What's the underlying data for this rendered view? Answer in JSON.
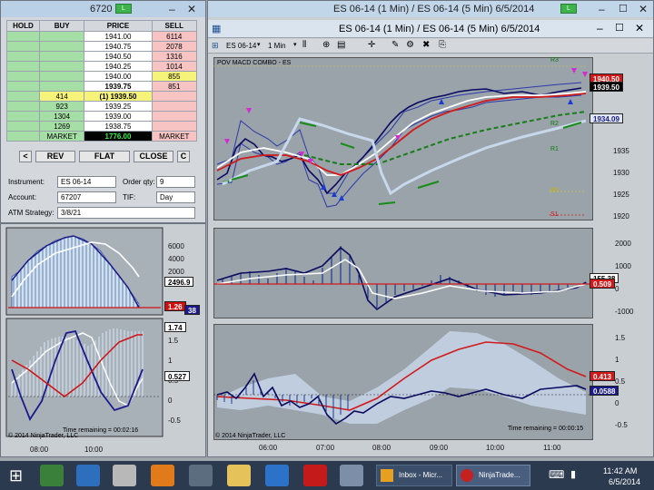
{
  "dom_window": {
    "title": "6720",
    "indicator": "L",
    "headers": [
      "HOLD",
      "BUY",
      "PRICE",
      "SELL"
    ],
    "rows": [
      {
        "hold": "",
        "buy": "",
        "price": "1941.00",
        "sell": "6114"
      },
      {
        "hold": "",
        "buy": "",
        "price": "1940.75",
        "sell": "2078"
      },
      {
        "hold": "",
        "buy": "",
        "price": "1940.50",
        "sell": "1316"
      },
      {
        "hold": "",
        "buy": "",
        "price": "1940.25",
        "sell": "1014"
      },
      {
        "hold": "",
        "buy": "",
        "price": "1940.00",
        "sell": "855"
      },
      {
        "hold": "",
        "buy": "",
        "price": "1939.75",
        "sell": "851"
      },
      {
        "hold": "",
        "buy": "414",
        "price": "(1) 1939.50",
        "sell": ""
      },
      {
        "hold": "",
        "buy": "923",
        "price": "1939.25",
        "sell": ""
      },
      {
        "hold": "",
        "buy": "1304",
        "price": "1939.00",
        "sell": ""
      },
      {
        "hold": "",
        "buy": "1269",
        "price": "1938.75",
        "sell": ""
      }
    ],
    "market_buy": "MARKET",
    "market_price": "1776.00",
    "market_sell": "MARKET",
    "buttons": {
      "left": "<",
      "rev": "REV",
      "flat": "FLAT",
      "close": "CLOSE",
      "c": "C"
    },
    "instrument_label": "Instrument:",
    "instrument_value": "ES 06-14",
    "order_qty_label": "Order qty:",
    "order_qty_value": "9",
    "account_label": "Account:",
    "account_value": "67207",
    "tif_label": "TIF:",
    "tif_value": "Day",
    "atm_label": "ATM Strategy:",
    "atm_value": "3/8/21"
  },
  "left_chart": {
    "upper_axis": [
      "6000",
      "4000",
      "2000"
    ],
    "upper_tags": {
      "white": "2496.9",
      "red": "1.26",
      "blue": "38"
    },
    "lower_axis": [
      "1.5",
      "1",
      "0.5",
      "0",
      "-0.5"
    ],
    "lower_tags": {
      "top": "1.74",
      "white": "0.527"
    },
    "copyright": "© 2014 NinjaTrader, LLC",
    "time_remaining": "Time remaining = 00:02:16",
    "time_labels": [
      "08:00",
      "10:00"
    ]
  },
  "main_chart": {
    "outer_title": "ES 06-14 (1 Min) / ES 06-14 (5 Min)  6/5/2014",
    "inner_title": "ES 06-14 (1 Min) / ES 06-14 (5 Min)  6/5/2014",
    "indicator": "L",
    "toolbar": {
      "instrument": "ES 06-14",
      "interval": "1 Min"
    },
    "panel_label": "POV MACD COMBO - ES",
    "price_axis": [
      "1935",
      "1930",
      "1925",
      "1920"
    ],
    "price_tags": {
      "last": "1939.50",
      "prev": "1940.50",
      "blue": "1934.09"
    },
    "levels": {
      "r3": "R3",
      "r2": "R2",
      "r1": "R1",
      "pp": "PP",
      "s1": "S1"
    },
    "macd_axis": [
      "2000",
      "1000",
      "0",
      "-1000"
    ],
    "macd_tags": {
      "white": "155.38",
      "red": "0.509"
    },
    "osc_axis": [
      "1.5",
      "1",
      "0.5",
      "0",
      "-0.5"
    ],
    "osc_tags": {
      "red": "0.413",
      "blue": "0.0588"
    },
    "copyright": "© 2014 NinjaTrader, LLC",
    "time_remaining": "Time remaining = 00:00:15",
    "time_labels": [
      "06:00",
      "07:00",
      "08:00",
      "09:00",
      "10:00",
      "11:00"
    ]
  },
  "taskbar": {
    "apps": [
      "Inbox - Micr...",
      "NinjaTrade..."
    ],
    "time": "11:42 AM",
    "date": "6/5/2014"
  }
}
